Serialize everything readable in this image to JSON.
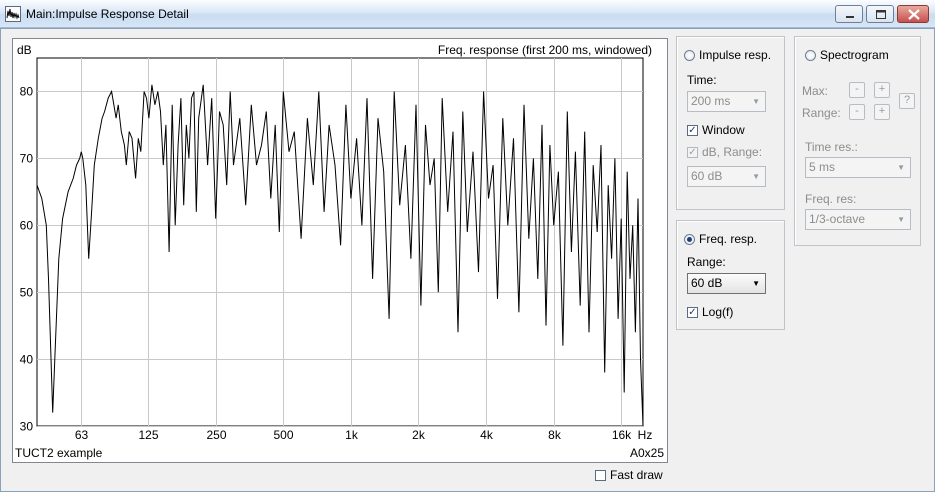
{
  "window": {
    "title": "Main:Impulse Response Detail"
  },
  "plot": {
    "y_unit": "dB",
    "header": "Freq. response  (first 200 ms, windowed)",
    "footer_left": "TUCT2 example",
    "footer_right": "A0x25",
    "fast_draw_label": "Fast draw",
    "fast_draw_checked": false
  },
  "chart_data": {
    "type": "line",
    "xscale": "log",
    "xlim": [
      40,
      20000
    ],
    "ylim": [
      30,
      85
    ],
    "xlabel": "Hz",
    "ylabel": "dB",
    "grid": true,
    "yticks": [
      30,
      40,
      50,
      60,
      70,
      80
    ],
    "xticks": [
      {
        "value": 63,
        "label": "63"
      },
      {
        "value": 125,
        "label": "125"
      },
      {
        "value": 250,
        "label": "250"
      },
      {
        "value": 500,
        "label": "500"
      },
      {
        "value": 1000,
        "label": "1k"
      },
      {
        "value": 2000,
        "label": "2k"
      },
      {
        "value": 4000,
        "label": "4k"
      },
      {
        "value": 8000,
        "label": "8k"
      },
      {
        "value": 16000,
        "label": "16k"
      }
    ],
    "series": [
      {
        "color": "#000000",
        "x": [
          40,
          42,
          44,
          45,
          46,
          47,
          48,
          50,
          52,
          55,
          58,
          60,
          62,
          63,
          64,
          66,
          68,
          70,
          72,
          75,
          78,
          80,
          83,
          86,
          90,
          92,
          95,
          98,
          100,
          103,
          106,
          110,
          113,
          116,
          120,
          123,
          126,
          130,
          134,
          138,
          142,
          146,
          150,
          155,
          160,
          165,
          170,
          175,
          180,
          185,
          190,
          195,
          200,
          205,
          210,
          220,
          230,
          240,
          250,
          260,
          270,
          280,
          290,
          300,
          320,
          340,
          360,
          380,
          400,
          420,
          440,
          460,
          480,
          500,
          530,
          560,
          600,
          640,
          680,
          720,
          760,
          800,
          850,
          900,
          950,
          1000,
          1060,
          1120,
          1180,
          1250,
          1320,
          1400,
          1480,
          1560,
          1650,
          1750,
          1850,
          1950,
          2050,
          2150,
          2250,
          2350,
          2450,
          2550,
          2700,
          2850,
          3000,
          3150,
          3300,
          3500,
          3700,
          3900,
          4100,
          4300,
          4500,
          4750,
          5000,
          5300,
          5600,
          5900,
          6200,
          6500,
          6800,
          7100,
          7400,
          7700,
          8000,
          8400,
          8800,
          9200,
          9600,
          10000,
          10500,
          11000,
          11500,
          12000,
          12500,
          13000,
          13500,
          14000,
          14500,
          15000,
          15500,
          16000,
          16500,
          17000,
          17500,
          18000,
          18500,
          19000,
          19500,
          20000
        ],
        "y": [
          66,
          64,
          60,
          52,
          42,
          32,
          40,
          55,
          61,
          65,
          67,
          69,
          70,
          71,
          70,
          66,
          55,
          62,
          69,
          73,
          76,
          77,
          79,
          80,
          76,
          78,
          74,
          72,
          69,
          74,
          73,
          67,
          73,
          71,
          80,
          79,
          76,
          81,
          78,
          80,
          77,
          69,
          75,
          56,
          78,
          60,
          72,
          79,
          63,
          75,
          70,
          79,
          80,
          62,
          76,
          81,
          69,
          79,
          61,
          77,
          75,
          66,
          80,
          69,
          76,
          63,
          78,
          69,
          72,
          77,
          64,
          75,
          59,
          80,
          71,
          74,
          58,
          76,
          66,
          80,
          62,
          75,
          69,
          57,
          78,
          64,
          73,
          60,
          79,
          52,
          76,
          68,
          46,
          80,
          63,
          72,
          55,
          78,
          48,
          75,
          66,
          70,
          50,
          79,
          62,
          74,
          44,
          77,
          59,
          71,
          53,
          80,
          64,
          69,
          49,
          76,
          60,
          73,
          47,
          78,
          58,
          70,
          52,
          75,
          45,
          72,
          60,
          68,
          42,
          77,
          56,
          71,
          48,
          74,
          44,
          69,
          59,
          72,
          38,
          66,
          55,
          70,
          46,
          61,
          35,
          68,
          52,
          60,
          44,
          64,
          40,
          30
        ]
      }
    ]
  },
  "impulse_panel": {
    "radio_label": "Impulse resp.",
    "radio_checked": false,
    "time_label": "Time:",
    "time_value": "200 ms",
    "window_label": "Window",
    "window_checked": true,
    "db_range_label": "dB, Range:",
    "db_range_checked": true,
    "db_range_value": "60 dB"
  },
  "freq_panel": {
    "radio_label": "Freq. resp.",
    "radio_checked": true,
    "range_label": "Range:",
    "range_value": "60 dB",
    "log_label": "Log(f)",
    "log_checked": true
  },
  "spectrogram_panel": {
    "radio_label": "Spectrogram",
    "radio_checked": false,
    "max_label": "Max:",
    "range_label": "Range:",
    "minus_label": "-",
    "plus_label": "+",
    "help_label": "?",
    "time_res_label": "Time res.:",
    "time_res_value": "5 ms",
    "freq_res_label": "Freq. res:",
    "freq_res_value": "1/3-octave"
  }
}
